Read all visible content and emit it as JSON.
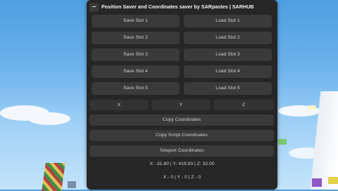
{
  "window": {
    "title": "Position Saver and Coordinates saver by SARpastes | SARHUB",
    "minimize_label": "–"
  },
  "slots": {
    "save": [
      "Save Slot 1",
      "Save Slot 2",
      "Save Slot 3",
      "Save Slot 4",
      "Save Slot 5"
    ],
    "load": [
      "Load Slot 1",
      "Load Slot 2",
      "Load Slot 3",
      "Load Slot 4",
      "Load Slot 5"
    ]
  },
  "coord_fields": {
    "x_placeholder": "X",
    "y_placeholder": "Y",
    "z_placeholder": "Z"
  },
  "actions": {
    "copy_coordinates": "Copy Coordinates",
    "copy_script_coordinates": "Copy Script Coordinates",
    "teleport_coordinates": "Teleport Coordinates"
  },
  "readouts": {
    "current_position": "X: -31.80 | Y: 419.50 | Z: 32.00",
    "offset": "X - 0 | Y - 0 | Z - 0"
  },
  "colors": {
    "panel_bg": "#262626",
    "button_bg": "#3a3a3a",
    "text": "#d8d8d8"
  }
}
